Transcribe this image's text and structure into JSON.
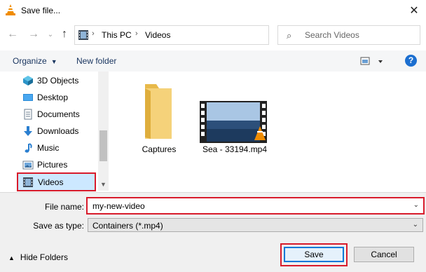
{
  "window": {
    "title": "Save file...",
    "icon": "vlc-cone-icon"
  },
  "nav": {
    "breadcrumb": [
      "This PC",
      "Videos"
    ],
    "search_placeholder": "Search Videos"
  },
  "toolbar": {
    "organize_label": "Organize",
    "new_folder_label": "New folder",
    "help_label": "?"
  },
  "sidebar": {
    "items": [
      {
        "label": "3D Objects",
        "icon": "3d-objects-icon"
      },
      {
        "label": "Desktop",
        "icon": "desktop-icon"
      },
      {
        "label": "Documents",
        "icon": "documents-icon"
      },
      {
        "label": "Downloads",
        "icon": "downloads-icon"
      },
      {
        "label": "Music",
        "icon": "music-icon"
      },
      {
        "label": "Pictures",
        "icon": "pictures-icon"
      },
      {
        "label": "Videos",
        "icon": "videos-icon",
        "selected": true
      }
    ]
  },
  "files": [
    {
      "name": "Captures",
      "type": "folder"
    },
    {
      "name": "Sea - 33194.mp4",
      "type": "video"
    }
  ],
  "form": {
    "file_name_label": "File name:",
    "file_name_value": "my-new-video",
    "save_type_label": "Save as type:",
    "save_type_value": "Containers (*.mp4)"
  },
  "footer": {
    "hide_folders_label": "Hide Folders",
    "save_label": "Save",
    "cancel_label": "Cancel"
  },
  "colors": {
    "highlight": "#d81b2b",
    "selection": "#cce8ff",
    "accent": "#0078d7"
  }
}
